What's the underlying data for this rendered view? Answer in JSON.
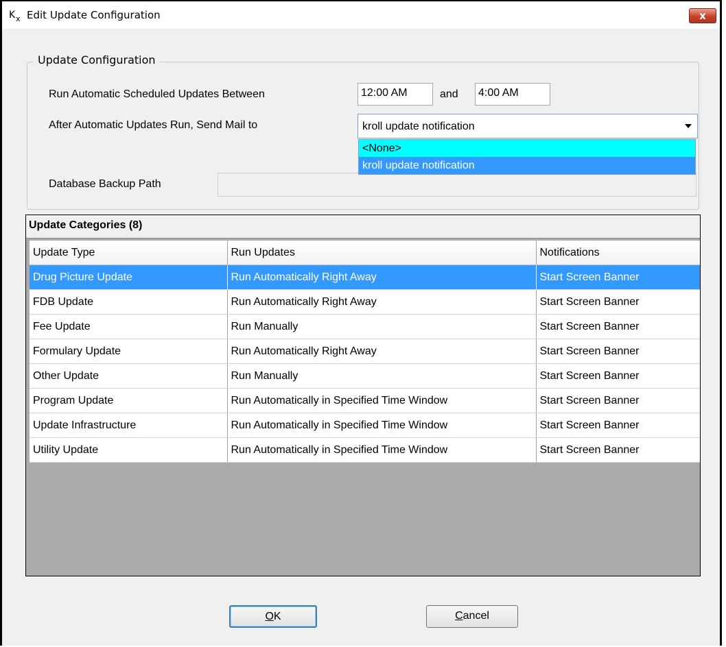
{
  "window": {
    "title": "Edit Update Configuration",
    "close_label": "x"
  },
  "config": {
    "group_title": "Update Configuration",
    "schedule_label": "Run Automatic Scheduled Updates Between",
    "start_time": "12:00 AM",
    "and_label": "and",
    "end_time": "4:00 AM",
    "mail_label": "After Automatic Updates Run, Send Mail to",
    "mail_selected": "kroll update notification",
    "mail_options": [
      "<None>",
      "kroll update notification"
    ],
    "backup_label": "Database Backup Path",
    "backup_path": ""
  },
  "categories": {
    "caption": "Update Categories (8)",
    "columns": [
      "Update Type",
      "Run Updates",
      "Notifications"
    ],
    "rows": [
      [
        "Drug Picture Update",
        "Run Automatically Right Away",
        "Start Screen Banner"
      ],
      [
        "FDB Update",
        "Run Automatically Right Away",
        "Start Screen Banner"
      ],
      [
        "Fee Update",
        "Run Manually",
        "Start Screen Banner"
      ],
      [
        "Formulary Update",
        "Run Automatically Right Away",
        "Start Screen Banner"
      ],
      [
        "Other Update",
        "Run Manually",
        "Start Screen Banner"
      ],
      [
        "Program Update",
        "Run Automatically in Specified Time Window",
        "Start Screen Banner"
      ],
      [
        "Update Infrastructure",
        "Run Automatically in Specified Time Window",
        "Start Screen Banner"
      ],
      [
        "Utility Update",
        "Run Automatically in Specified Time Window",
        "Start Screen Banner"
      ]
    ],
    "selected_row": 0
  },
  "buttons": {
    "ok_mnemonic": "O",
    "ok_rest": "K",
    "cancel_mnemonic": "C",
    "cancel_rest": "ancel"
  },
  "colors": {
    "selection": "#3399ff",
    "dropdown_highlight": "#00ffff"
  }
}
